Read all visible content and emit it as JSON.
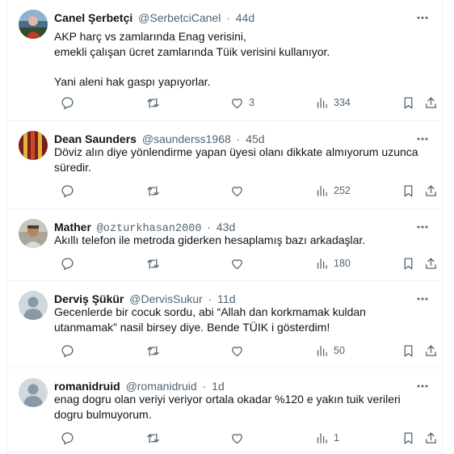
{
  "tweets": [
    {
      "name": "Canel Şerbetçi",
      "handle": "@SerbetciCanel",
      "time": "44d",
      "text": "AKP harç vs zamlarında Enag verisini,\nemekli çalışan ücret zamlarında Tüik verisini kullanıyor.\n\nYani aleni hak gaspı yapıyorlar.",
      "likes": "3",
      "views": "334"
    },
    {
      "name": "Dean Saunders",
      "handle": "@saunderss1968",
      "time": "45d",
      "text": "Döviz alın diye yönlendirme yapan üyesi olanı dikkate almıyorum uzunca süredir.",
      "likes": "",
      "views": "252"
    },
    {
      "name": "Mather",
      "handle": "@ozturkhasan2000",
      "time": "43d",
      "text": "Akıllı telefon ile metroda giderken hesaplamış bazı arkadaşlar.",
      "likes": "",
      "views": "180"
    },
    {
      "name": "Derviş Şükür",
      "handle": "@DervisSukur",
      "time": "11d",
      "text": "Gecenlerde bir cocuk sordu, abi “Allah dan korkmamak kuldan utanmamak” nasil birsey diye. Bende TÜIK i gösterdim!",
      "likes": "",
      "views": "50"
    },
    {
      "name": "romanidruid",
      "handle": "@romanidruid",
      "time": "1d",
      "text": "enag  dogru olan veriyi veriyor ortala okadar %120 e yakın  tuik   verileri dogru bulmuyorum.",
      "likes": "",
      "views": "1"
    }
  ],
  "separator": "·",
  "icons": {
    "more": "more-horizontal-icon",
    "reply": "reply-icon",
    "retweet": "retweet-icon",
    "like": "heart-icon",
    "views": "views-chart-icon",
    "bookmark": "bookmark-icon",
    "share": "share-icon"
  },
  "colors": {
    "text": "#0f1419",
    "secondary": "#536471",
    "border": "#eff3f4",
    "default_avatar": "#cfd9de"
  }
}
